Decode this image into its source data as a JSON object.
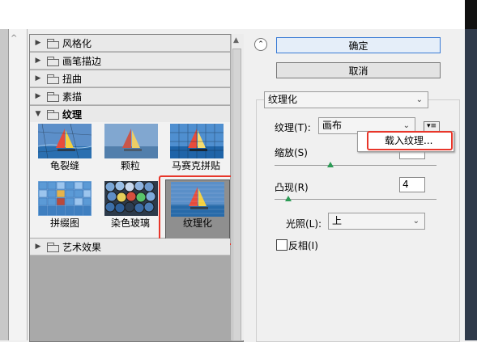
{
  "categories": [
    {
      "label": "风格化",
      "expanded": false
    },
    {
      "label": "画笔描边",
      "expanded": false
    },
    {
      "label": "扭曲",
      "expanded": false
    },
    {
      "label": "素描",
      "expanded": false
    },
    {
      "label": "纹理",
      "expanded": true
    },
    {
      "label": "艺术效果",
      "expanded": false
    }
  ],
  "filters": [
    {
      "label": "龟裂缝"
    },
    {
      "label": "颗粒"
    },
    {
      "label": "马赛克拼贴"
    },
    {
      "label": "拼缀图"
    },
    {
      "label": "染色玻璃"
    },
    {
      "label": "纹理化",
      "selected": true
    }
  ],
  "buttons": {
    "ok": "确定",
    "cancel": "取消"
  },
  "filter_select": {
    "value": "纹理化"
  },
  "texture": {
    "label": "纹理(T):",
    "value": "画布",
    "menu_item": "载入纹理..."
  },
  "scaling": {
    "label": "缩放(S)",
    "value": "",
    "percent": 60
  },
  "relief": {
    "label": "凸现(R)",
    "value": "4",
    "percent": 8
  },
  "light": {
    "label": "光照(L):",
    "value": "上"
  },
  "invert": {
    "label": "反相(I)",
    "checked": false
  },
  "colors": {
    "accent": "#3a7bd5",
    "highlight": "#e8362a",
    "knob": "#2c9b55"
  }
}
